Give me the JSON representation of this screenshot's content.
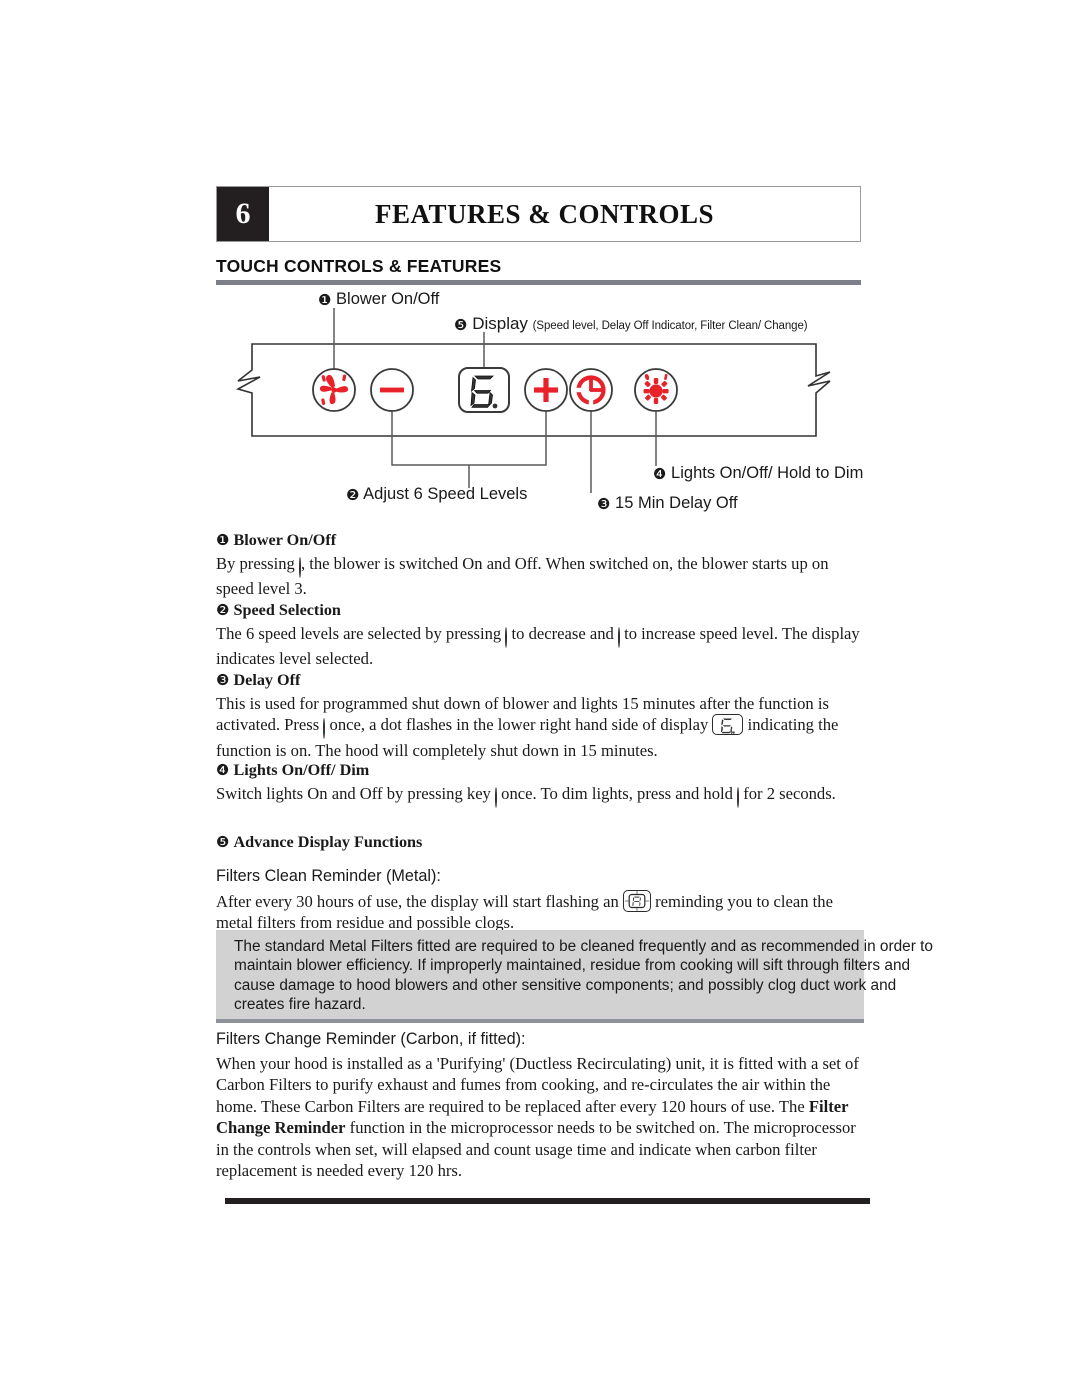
{
  "chapter": {
    "number": "6",
    "title": "FEATURES & CONTROLS"
  },
  "section": {
    "heading": "TOUCH CONTROLS & FEATURES"
  },
  "diagram": {
    "callouts": {
      "blower": {
        "num": "❶",
        "text": "Blower On/Off"
      },
      "display": {
        "num": "❺",
        "text": "Display",
        "sub": "(Speed level, Delay Off Indicator, Filter Clean/ Change)"
      },
      "speed": {
        "num": "❷",
        "text": "Adjust 6 Speed Levels"
      },
      "delay": {
        "num": "❸",
        "text": "15 Min Delay Off"
      },
      "lights": {
        "num": "❹",
        "text": "Lights On/Off/ Hold to Dim"
      }
    },
    "keys": [
      {
        "name": "blower-key",
        "icon": "fan-icon",
        "color": "#e8212a"
      },
      {
        "name": "minus-key",
        "icon": "minus-icon",
        "color": "#e8212a"
      },
      {
        "name": "display-panel",
        "icon": "seven-segment-display",
        "value": "6.",
        "color": "#2b2b2b"
      },
      {
        "name": "plus-key",
        "icon": "plus-icon",
        "color": "#e8212a"
      },
      {
        "name": "delay-key",
        "icon": "clock-icon",
        "color": "#e8212a"
      },
      {
        "name": "lights-key",
        "icon": "light-bulb-icon",
        "color": "#e8212a"
      }
    ]
  },
  "items": [
    {
      "num": "❶",
      "title": "Blower On/Off",
      "body_pre": "By pressing ",
      "body_mid": ", the blower is switched On and Off.  When switched on, the blower starts up on speed level 3.",
      "icon": "fan-icon"
    },
    {
      "num": "❷",
      "title": "Speed Selection",
      "body_pre": "The 6 speed levels are selected by pressing ",
      "body_mid": " to decrease and ",
      "body_post": " to increase speed level.  The display indicates level selected.",
      "icons": [
        "minus-icon",
        "plus-icon"
      ]
    },
    {
      "num": "❸",
      "title": "Delay Off",
      "body_pre": "This is used for programmed shut down of blower and lights 15 minutes after the function is activated.  Press ",
      "body_mid": " once, a dot flashes in the lower right hand side of display ",
      "body_post": " indicating the function is on.  The hood will completely shut down in 15 minutes.",
      "icons": [
        "clock-icon",
        "seven-segment-display"
      ]
    },
    {
      "num": "❹",
      "title": "Lights On/Off/ Dim",
      "body_pre": "Switch lights On and Off by pressing key ",
      "body_mid": " once.  To dim lights, press and hold ",
      "body_post": " for 2 seconds.",
      "icons": [
        "light-bulb-icon",
        "light-bulb-icon"
      ]
    },
    {
      "num": "❺",
      "title": "Advance Display Functions"
    }
  ],
  "filters_clean": {
    "heading": "Filters Clean Reminder (Metal):",
    "body_pre": "After every 30 hours of use, the display will start flashing an ",
    "body_post": " reminding you to clean the metal filters from residue and possible clogs.",
    "display_value": "A"
  },
  "warning_box": {
    "text": "The standard Metal Filters fitted are required to be cleaned frequently and as recommended in order to maintain blower efficiency.  If  improperly maintained, residue from cooking will sift through filters and cause damage to hood blowers and other sensitive components; and possibly clog duct work and creates fire hazard.",
    "background": "#d2d2d2"
  },
  "filters_change": {
    "heading": "Filters Change Reminder (Carbon, if fitted):",
    "p1": "When your hood is installed as a 'Purifying' (Ductless Recirculating) unit, it is fitted with a set of Carbon Filters to purify exhaust and fumes from cooking, and re-circulates the air within the home. These Carbon Filters are required to be replaced after every 120 hours of use.  The ",
    "bold1": "Filter Change Reminder",
    "p2": " function in the microprocessor needs to be switched on.  The microprocessor in the controls when set, will elapsed and count usage time and indicate when carbon filter replacement is needed every 120 hrs."
  },
  "colors": {
    "accent_red": "#e8212a",
    "rule_gray": "#7c7f87",
    "rule_black": "#231f20",
    "box_gray": "#d2d2d2"
  }
}
